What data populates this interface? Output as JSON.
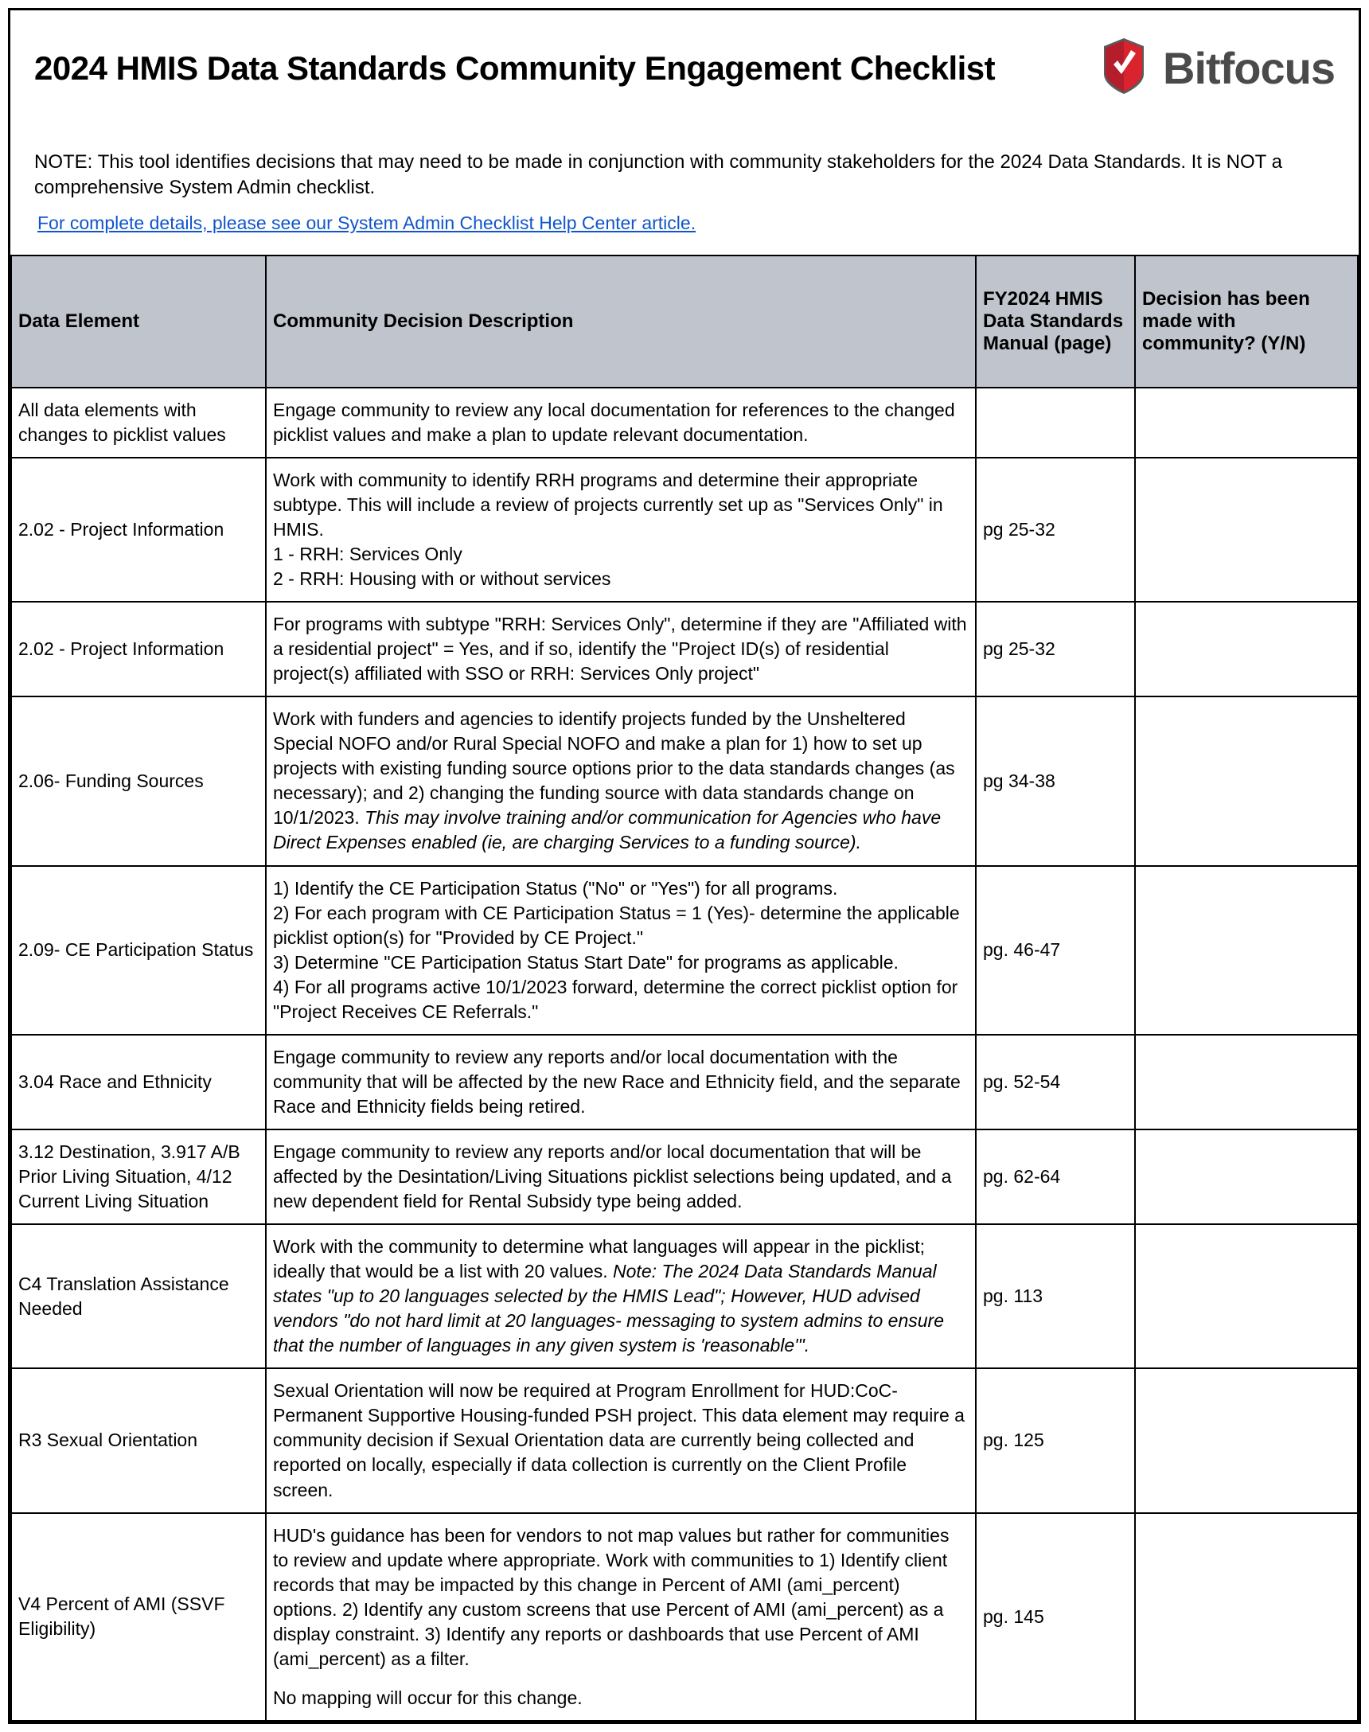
{
  "header": {
    "title": "2024 HMIS Data Standards Community Engagement Checklist",
    "logo_text": "Bitfocus",
    "note": "NOTE: This tool identifies decisions that may need to be made in conjunction with community stakeholders for the 2024 Data Standards. It is NOT a comprehensive System Admin checklist.",
    "help_link_text": " For complete details, please see our System Admin Checklist Help Center article."
  },
  "table": {
    "headers": {
      "data_element": "Data Element",
      "description": "Community Decision Description",
      "manual_page": "FY2024 HMIS Data Standards Manual (page)",
      "decision": "Decision has been made with community? (Y/N)"
    },
    "rows": [
      {
        "data_element": "All data elements with changes to picklist values",
        "description": "Engage community to review any local documentation for references to the changed picklist values and make a plan to update relevant documentation.",
        "manual_page": "",
        "decision": ""
      },
      {
        "data_element": "2.02 - Project Information",
        "description": "Work with community to identify RRH programs and determine their appropriate subtype. This will include a review of projects currently set up as \"Services Only\" in HMIS.\n1 - RRH: Services Only\n2 - RRH: Housing with or without services",
        "manual_page": "pg 25-32",
        "decision": ""
      },
      {
        "data_element": "2.02 - Project Information",
        "description": "For programs with subtype \"RRH: Services Only\", determine if they are \"Affiliated with a residential project\" = Yes, and if so, identify the \"Project ID(s) of residential project(s) affiliated with SSO or RRH: Services Only project\"",
        "manual_page": "pg 25-32",
        "decision": ""
      },
      {
        "data_element": "2.06- Funding Sources",
        "description_pre": "Work with funders and agencies to identify projects funded by the Unsheltered Special NOFO and/or Rural Special NOFO and make a plan for 1) how to set up projects with existing funding source options prior to the data standards changes (as necessary); and 2) changing the funding source with data standards change on 10/1/2023. ",
        "description_italic": "This may involve training and/or communication for Agencies who have Direct Expenses enabled (ie, are charging Services to a funding source).",
        "manual_page": "pg 34-38",
        "decision": ""
      },
      {
        "data_element": "2.09- CE Participation Status",
        "description": "1) Identify the CE Participation Status (\"No\" or \"Yes\") for all programs.\n2) For each program with CE Participation Status = 1 (Yes)- determine the applicable picklist option(s) for \"Provided by CE Project.\"\n3) Determine \"CE Participation Status Start Date\" for programs as applicable.\n4) For all programs active 10/1/2023 forward, determine the correct picklist option for \"Project Receives CE Referrals.\"",
        "manual_page": "pg. 46-47",
        "decision": ""
      },
      {
        "data_element": "3.04 Race and Ethnicity",
        "description": "Engage community to review any reports and/or local documentation with the community that will be affected by the new Race and Ethnicity field, and the separate Race and Ethnicity fields being retired.",
        "manual_page": "pg. 52-54",
        "decision": ""
      },
      {
        "data_element": "3.12 Destination, 3.917 A/B Prior Living Situation, 4/12 Current Living Situation",
        "description": "Engage community to review any reports and/or local documentation that will be affected by the Desintation/Living Situations picklist selections being updated, and a new dependent field for Rental Subsidy type being added.",
        "manual_page": "pg. 62-64",
        "decision": ""
      },
      {
        "data_element": "C4 Translation Assistance Needed",
        "description_pre": "Work with the community to determine what languages will appear in the picklist; ideally that would be a list with 20 values. ",
        "description_italic": "Note: The 2024 Data Standards Manual states \"up to 20 languages selected by the HMIS Lead\";  However, HUD advised vendors \"do not hard limit at 20 languages- messaging to system admins to ensure that the number of languages in any given system is 'reasonable'\".",
        "manual_page": "pg. 113",
        "decision": ""
      },
      {
        "data_element": "R3 Sexual Orientation",
        "description": "Sexual Orientation will now be required at Program Enrollment for HUD:CoC-Permanent Supportive Housing-funded PSH project. This data element may require a community decision if Sexual Orientation data are currently being collected and reported on locally, especially if data collection is currently on the Client Profile screen.",
        "manual_page": "pg. 125",
        "decision": ""
      },
      {
        "data_element": "V4 Percent of AMI (SSVF Eligibility)",
        "description_p1": "HUD's guidance has been for vendors to not map values but rather for communities to review and update where appropriate. Work with communities to 1) Identify client records that may be impacted by this change in Percent of AMI (ami_percent) options. 2) Identify any custom screens that use Percent of AMI (ami_percent) as a display constraint. 3) Identify any reports or dashboards that use Percent of AMI (ami_percent) as a filter.",
        "description_p2": " No mapping will occur for this change.",
        "manual_page": "pg. 145",
        "decision": ""
      }
    ]
  }
}
